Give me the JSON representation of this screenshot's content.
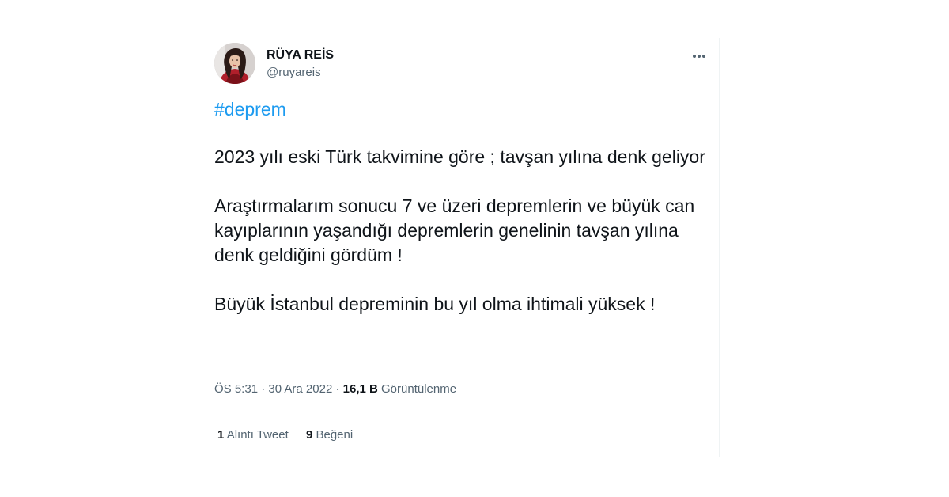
{
  "tweet": {
    "author": {
      "display_name": "RÜYA REİS",
      "handle": "@ruyareis"
    },
    "hashtag": "#deprem",
    "paragraphs": [
      "2023 yılı eski Türk takvimine göre ; tavşan yılına denk geliyor",
      "Araştırmalarım sonucu 7 ve üzeri depremlerin ve büyük can kayıplarının yaşandığı depremlerin genelinin tavşan yılına denk geldiğini gördüm !",
      "Büyük İstanbul depreminin bu yıl olma ihtimali yüksek !"
    ],
    "meta": {
      "time": "ÖS 5:31",
      "separator": "·",
      "date": "30 Ara 2022",
      "views_count": "16,1 B",
      "views_label": "Görüntülenme"
    },
    "stats": {
      "quote_count": "1",
      "quote_label": "Alıntı Tweet",
      "like_count": "9",
      "like_label": "Beğeni"
    },
    "icons": {
      "more": "more-horizontal-icon"
    },
    "colors": {
      "link": "#1d9bf0",
      "secondary_text": "#536471",
      "primary_text": "#0f1419",
      "divider": "#eff3f4"
    }
  }
}
